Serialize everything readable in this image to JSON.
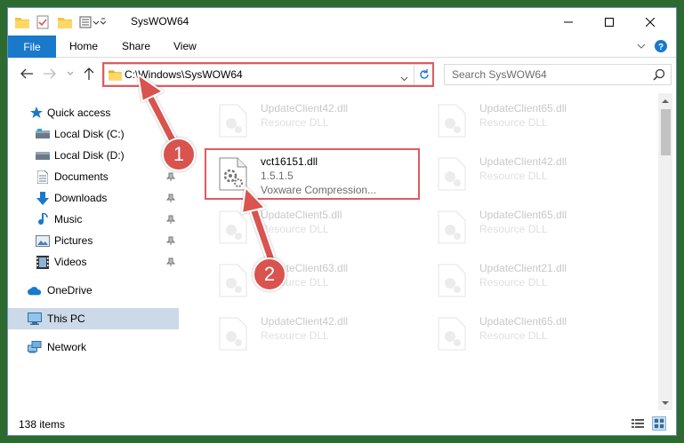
{
  "window": {
    "title": "SysWOW64",
    "controls": [
      "minimize",
      "maximize",
      "close"
    ]
  },
  "ribbon": {
    "tabs": [
      {
        "label": "File",
        "active": true
      },
      {
        "label": "Home"
      },
      {
        "label": "Share"
      },
      {
        "label": "View"
      }
    ]
  },
  "address": {
    "path": "C:\\Windows\\SysWOW64"
  },
  "search": {
    "placeholder": "Search SysWOW64"
  },
  "sidebar": {
    "items": [
      {
        "label": "Quick access",
        "icon": "star-icon"
      },
      {
        "label": "Local Disk (C:)",
        "icon": "drive-icon",
        "pinned": true
      },
      {
        "label": "Local Disk (D:)",
        "icon": "drive-icon",
        "pinned": true
      },
      {
        "label": "Documents",
        "icon": "document-icon",
        "pinned": true
      },
      {
        "label": "Downloads",
        "icon": "download-icon",
        "pinned": true
      },
      {
        "label": "Music",
        "icon": "music-icon",
        "pinned": true
      },
      {
        "label": "Pictures",
        "icon": "picture-icon",
        "pinned": true
      },
      {
        "label": "Videos",
        "icon": "video-icon",
        "pinned": true
      },
      {
        "label": "OneDrive",
        "icon": "cloud-icon"
      },
      {
        "label": "This PC",
        "icon": "computer-icon",
        "selected": true
      },
      {
        "label": "Network",
        "icon": "network-icon"
      }
    ]
  },
  "files": {
    "left": [
      {
        "name": "UpdateClient42.dll",
        "type": "Resource DLL",
        "faded": true
      },
      {
        "name": "vct16151.dll",
        "version": "1.5.1.5",
        "description": "Voxware Compression...",
        "highlighted": true
      },
      {
        "name": "UpdateClient5.dll",
        "type": "Resource DLL",
        "faded": true
      },
      {
        "name": "UpdateClient63.dll",
        "type": "Resource DLL",
        "faded": true
      },
      {
        "name": "UpdateClient42.dll",
        "type": "Resource DLL",
        "faded": true
      }
    ],
    "right": [
      {
        "name": "UpdateClient65.dll",
        "type": "Resource DLL",
        "faded": true
      },
      {
        "name": "UpdateClient42.dll",
        "type": "Resource DLL",
        "faded": true
      },
      {
        "name": "UpdateClient65.dll",
        "type": "Resource DLL",
        "faded": true
      },
      {
        "name": "UpdateClient21.dll",
        "type": "Resource DLL",
        "faded": true
      },
      {
        "name": "UpdateClient65.dll",
        "type": "Resource DLL",
        "faded": true
      }
    ]
  },
  "status": {
    "items": "138 items"
  },
  "annotations": {
    "step1": "1",
    "step2": "2",
    "color": "#d9534f"
  },
  "colors": {
    "accent": "#1979ca",
    "selection": "#ccd9e8",
    "highlight_box": "#e05a5f",
    "desktop": "#2d6a2f"
  }
}
